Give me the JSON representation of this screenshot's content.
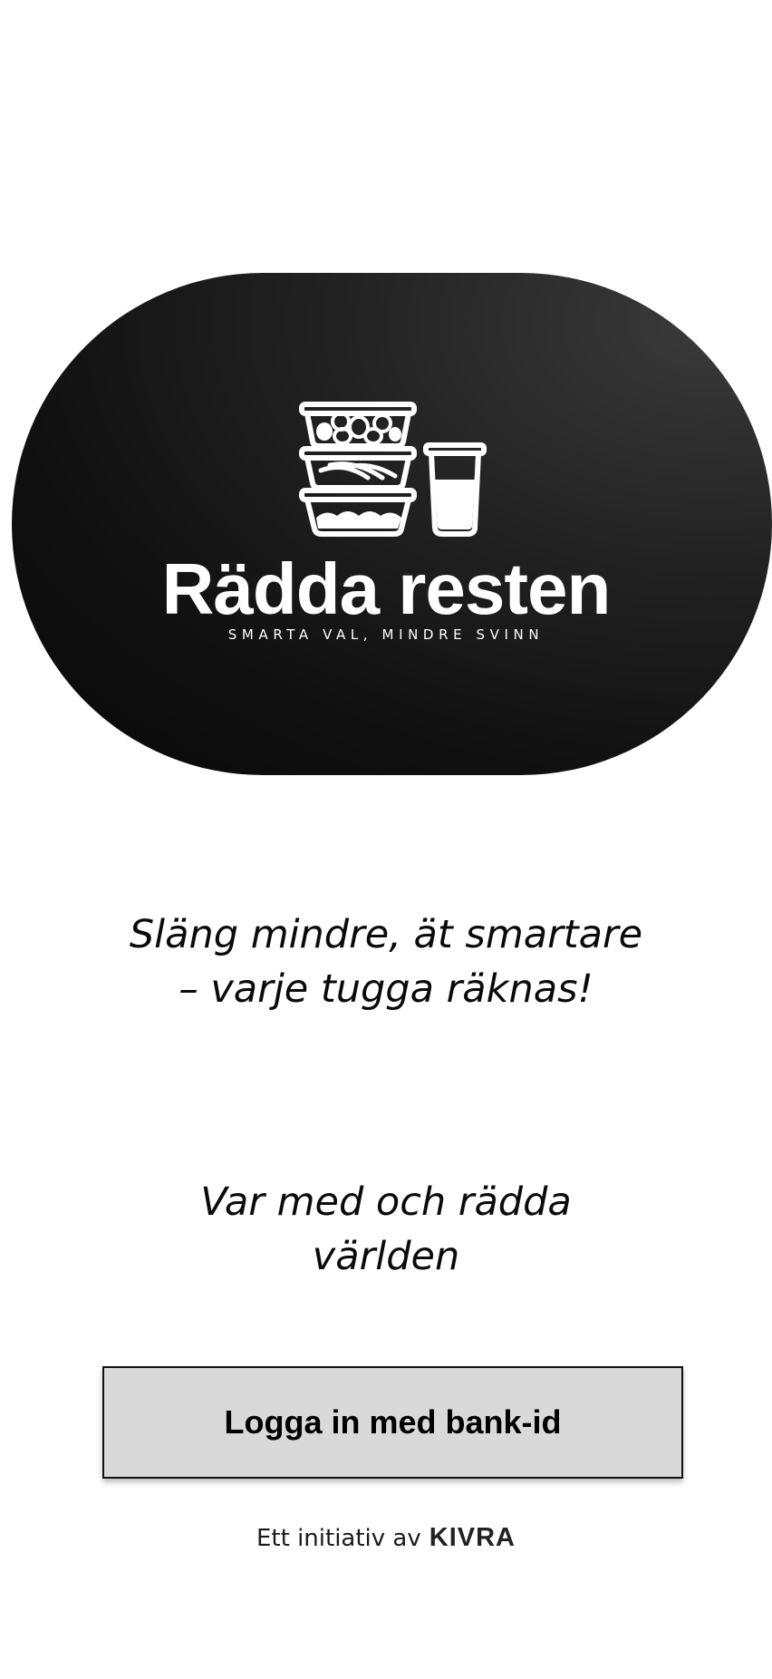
{
  "logo": {
    "title": "Rädda resten",
    "tagline": "SMARTA VAL, MINDRE SVINN",
    "icon": "food-containers-and-glass-icon",
    "background": "#111111"
  },
  "slogan_primary": {
    "line1": "Släng mindre, ät smartare",
    "line2": "– varje tugga räknas!"
  },
  "slogan_secondary": {
    "line1": "Var med och rädda",
    "line2": "världen"
  },
  "login_button": {
    "label": "Logga in med bank-id",
    "background": "#d9d9d9"
  },
  "footer": {
    "text": "Ett initiativ av",
    "brand": "KIVRA"
  }
}
